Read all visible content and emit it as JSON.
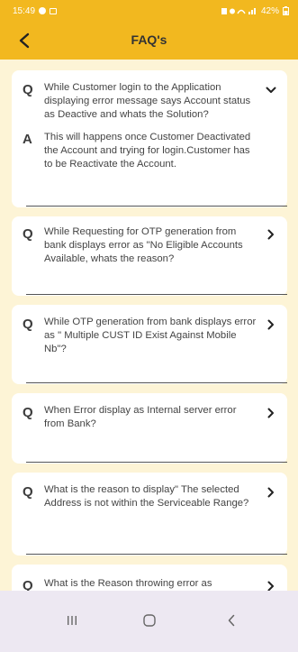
{
  "status_bar": {
    "time": "15:49",
    "battery": "42%"
  },
  "header": {
    "title": "FAQ's"
  },
  "faqs": [
    {
      "q_label": "Q",
      "question": "While Customer login to the Application displaying error message says Account status as Deactive and whats the Solution?",
      "expanded": true,
      "a_label": "A",
      "answer": "This will happens once Customer Deactivated the Account and trying for login.Customer has to be Reactivate the Account."
    },
    {
      "q_label": "Q",
      "question": "While Requesting for OTP generation from bank displays error as \"No Eligible Accounts Available, whats the reason?",
      "expanded": false
    },
    {
      "q_label": "Q",
      "question": "While OTP generation from bank displays error as \" Multiple CUST ID Exist Against Mobile Nb\"?",
      "expanded": false
    },
    {
      "q_label": "Q",
      "question": "When Error display as Internal server error from Bank?",
      "expanded": false
    },
    {
      "q_label": "Q",
      "question": "What is the reason to display\" The selected Address is not within the Serviceable Range?",
      "expanded": false
    },
    {
      "q_label": "Q",
      "question": "What is the Reason throwing error as \"Connection Error while Service Booking confirmation time?",
      "expanded": false
    }
  ],
  "colors": {
    "header_bg": "#f2b81f",
    "content_bg": "#fdf4d6",
    "card_bg": "#ffffff",
    "nav_bg": "#ede8f2"
  },
  "icons": {
    "back": "chevron-left-icon",
    "expanded": "chevron-down-icon",
    "collapsed": "chevron-right-icon",
    "nav_recents": "recents-icon",
    "nav_home": "home-icon",
    "nav_back": "back-icon"
  }
}
